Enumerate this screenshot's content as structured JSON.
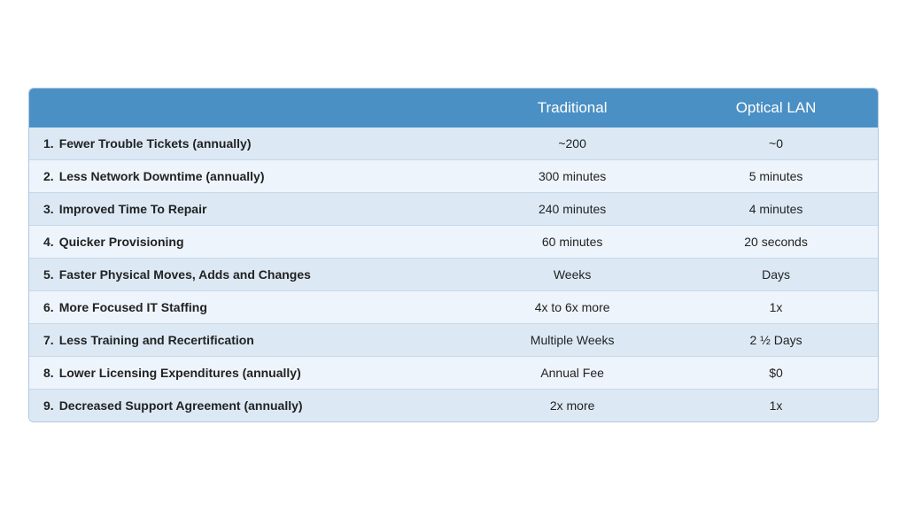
{
  "header": {
    "col_empty": "",
    "col_traditional": "Traditional",
    "col_optical": "Optical LAN"
  },
  "rows": [
    {
      "num": "1.",
      "label": "Fewer Trouble Tickets (annually)",
      "traditional": "~200",
      "optical": "~0"
    },
    {
      "num": "2.",
      "label": "Less Network Downtime (annually)",
      "traditional": "300 minutes",
      "optical": "5 minutes"
    },
    {
      "num": "3.",
      "label": "Improved Time To Repair",
      "traditional": "240 minutes",
      "optical": "4 minutes"
    },
    {
      "num": "4.",
      "label": "Quicker Provisioning",
      "traditional": "60 minutes",
      "optical": "20 seconds"
    },
    {
      "num": "5.",
      "label": "Faster Physical Moves, Adds and Changes",
      "traditional": "Weeks",
      "optical": "Days"
    },
    {
      "num": "6.",
      "label": "More Focused IT Staffing",
      "traditional": "4x to 6x more",
      "optical": "1x"
    },
    {
      "num": "7.",
      "label": "Less Training and Recertification",
      "traditional": "Multiple Weeks",
      "optical": "2 ½ Days"
    },
    {
      "num": "8.",
      "label": "Lower Licensing Expenditures (annually)",
      "traditional": "Annual Fee",
      "optical": "$0"
    },
    {
      "num": "9.",
      "label": "Decreased Support Agreement (annually)",
      "traditional": "2x more",
      "optical": "1x"
    }
  ]
}
